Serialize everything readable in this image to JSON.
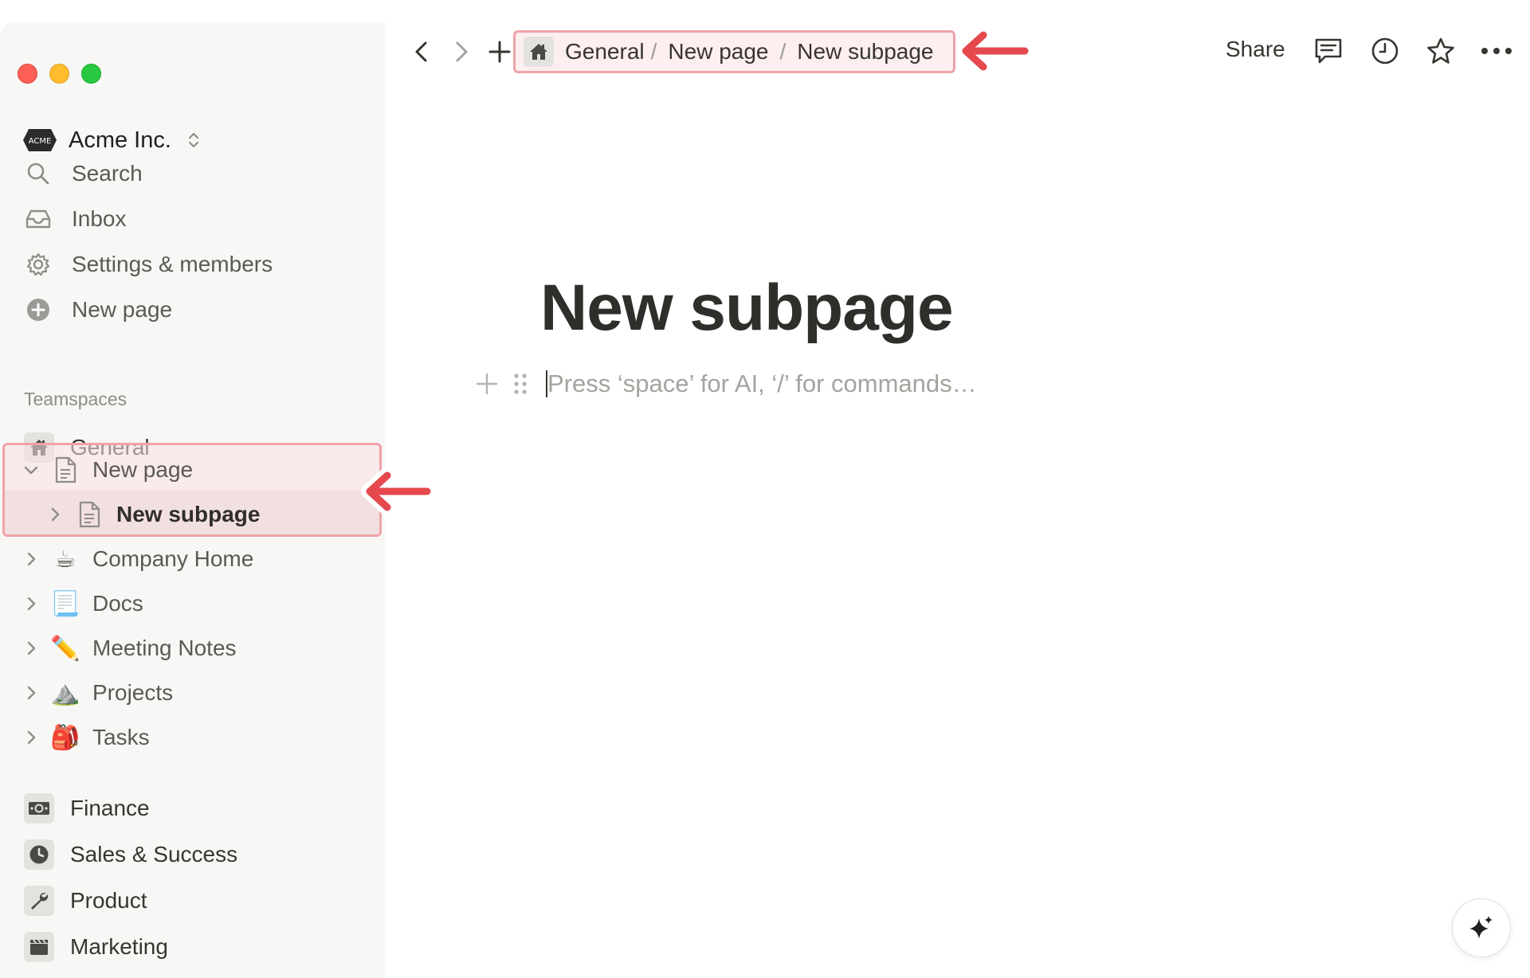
{
  "workspace": {
    "name": "Acme Inc.",
    "logo_text": "ACME"
  },
  "sidebar": {
    "nav": [
      {
        "label": "Search",
        "icon": "search-icon"
      },
      {
        "label": "Inbox",
        "icon": "inbox-icon"
      },
      {
        "label": "Settings & members",
        "icon": "gear-icon"
      },
      {
        "label": "New page",
        "icon": "plus-circle-icon"
      }
    ],
    "teamspaces_label": "Teamspaces",
    "tree": [
      {
        "label": "General",
        "icon": "home-icon"
      },
      {
        "label": "New page",
        "icon": "page-icon",
        "expanded": true
      },
      {
        "label": "New subpage",
        "icon": "page-icon",
        "selected": true
      },
      {
        "label": "Company Home",
        "emoji": "☕"
      },
      {
        "label": "Docs",
        "emoji": "📃"
      },
      {
        "label": "Meeting Notes",
        "emoji": "✏️"
      },
      {
        "label": "Projects",
        "emoji": "⛰️"
      },
      {
        "label": "Tasks",
        "emoji": "🎒"
      }
    ],
    "teams": [
      {
        "label": "Finance",
        "icon": "money-icon"
      },
      {
        "label": "Sales & Success",
        "icon": "clock-icon"
      },
      {
        "label": "Product",
        "icon": "wrench-icon"
      },
      {
        "label": "Marketing",
        "icon": "clapper-icon"
      }
    ]
  },
  "breadcrumb": {
    "items": [
      "General",
      "New page",
      "New subpage"
    ],
    "separator": "/"
  },
  "toolbar": {
    "share_label": "Share"
  },
  "page": {
    "title": "New subpage",
    "placeholder": "Press ‘space’ for AI, ‘/’ for commands…"
  },
  "colors": {
    "highlight_border": "#eea3a8",
    "highlight_fill": "#fbe0e2",
    "arrow": "#e5484d",
    "sidebar_bg": "#f7f7f5"
  }
}
